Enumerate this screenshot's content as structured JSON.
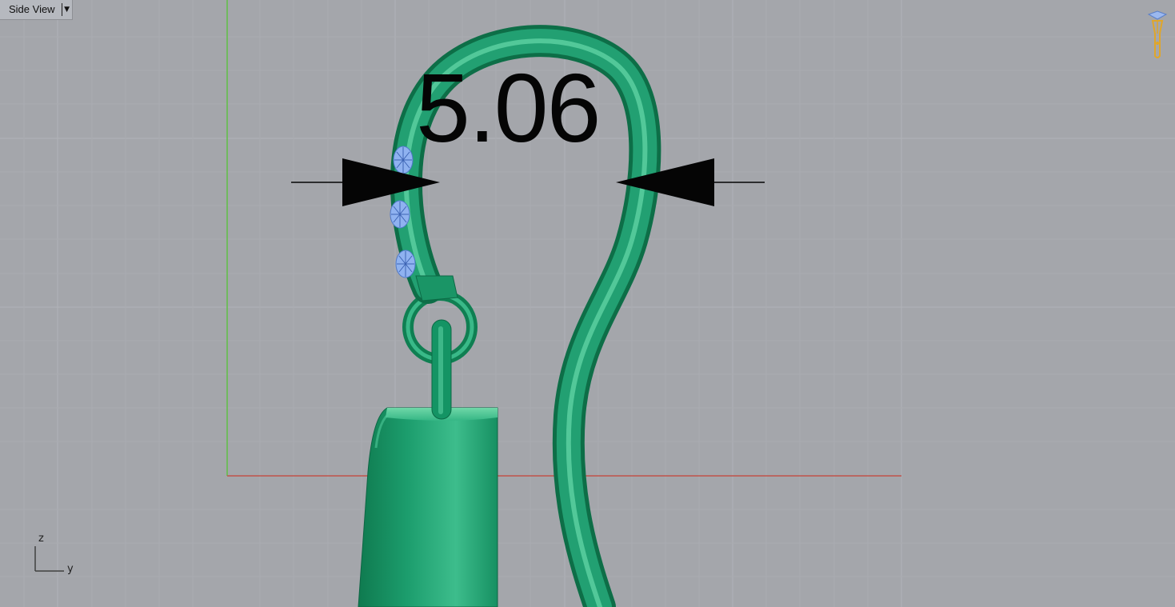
{
  "viewport": {
    "title": "Side View",
    "dropdown_icon": "triangle-down-icon"
  },
  "dimension": {
    "value": "5.06"
  },
  "axis_indicator": {
    "vertical": "z",
    "horizontal": "y"
  },
  "colors": {
    "background": "#a4a6ab",
    "grid": "#b0b2b7",
    "model": "#27a77a",
    "gems": "#8fb2f0",
    "axis_x": "#c0524a",
    "axis_z": "#5fbf44",
    "dimension": "#050505"
  }
}
